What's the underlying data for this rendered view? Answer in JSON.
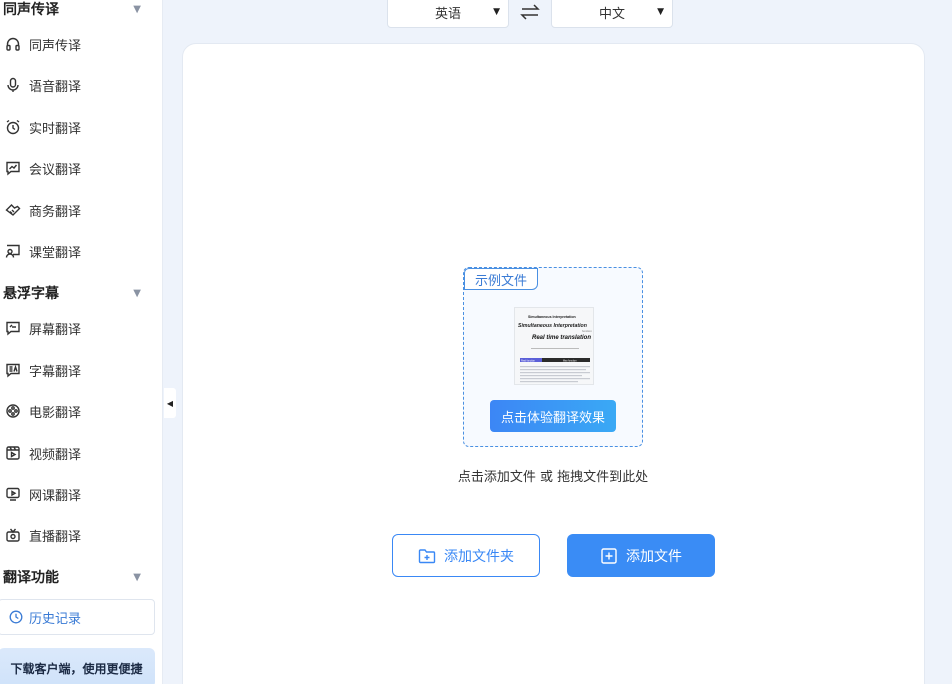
{
  "sidebar": {
    "sections": [
      {
        "title": "同声传译"
      },
      {
        "title": "悬浮字幕"
      },
      {
        "title": "翻译功能"
      }
    ],
    "items": [
      {
        "label": "同声传译",
        "icon": "headphones-icon"
      },
      {
        "label": "语音翻译",
        "icon": "microphone-icon"
      },
      {
        "label": "实时翻译",
        "icon": "alarm-clock-icon"
      },
      {
        "label": "会议翻译",
        "icon": "chat-chart-icon"
      },
      {
        "label": "商务翻译",
        "icon": "handshake-icon"
      },
      {
        "label": "课堂翻译",
        "icon": "classroom-icon"
      },
      {
        "label": "屏幕翻译",
        "icon": "screen-chat-icon"
      },
      {
        "label": "字幕翻译",
        "icon": "subtitle-icon"
      },
      {
        "label": "电影翻译",
        "icon": "film-reel-icon"
      },
      {
        "label": "视频翻译",
        "icon": "video-icon"
      },
      {
        "label": "网课翻译",
        "icon": "monitor-play-icon"
      },
      {
        "label": "直播翻译",
        "icon": "camera-live-icon"
      }
    ],
    "history_label": "历史记录",
    "download_banner": "下载客户端，使用更便捷"
  },
  "language_bar": {
    "source": "英语",
    "target": "中文"
  },
  "upload": {
    "sample_tag": "示例文件",
    "sample_thumb": {
      "line1": "Simultaneous Interpretation",
      "line2": "Simultaneous Interpretation",
      "line3": "Real time translation",
      "left_label": "Real function",
      "right_label": "Max function"
    },
    "try_button": "点击体验翻译效果",
    "hint": "点击添加文件 或 拖拽文件到此处",
    "add_folder_button": "添加文件夹",
    "add_file_button": "添加文件"
  },
  "colors": {
    "accent": "#3a8cf5",
    "page_bg": "#eef3fb"
  }
}
